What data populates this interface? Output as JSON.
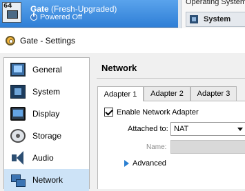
{
  "vm_list": {
    "selected_vm": {
      "arch_badge": "64",
      "name": "Gate",
      "snapshot": "(Fresh-Upgraded)",
      "state": "Powered Off"
    }
  },
  "details": {
    "os_label": "Operating System:",
    "system_header": "System"
  },
  "dialog": {
    "title": "Gate - Settings",
    "sidebar": [
      {
        "label": "General",
        "icon": "general-icon"
      },
      {
        "label": "System",
        "icon": "system-icon"
      },
      {
        "label": "Display",
        "icon": "display-icon"
      },
      {
        "label": "Storage",
        "icon": "storage-icon"
      },
      {
        "label": "Audio",
        "icon": "audio-icon"
      },
      {
        "label": "Network",
        "icon": "network-icon",
        "selected": true
      }
    ],
    "section_title": "Network",
    "tabs": [
      {
        "label": "Adapter 1",
        "active": true
      },
      {
        "label": "Adapter 2"
      },
      {
        "label": "Adapter 3"
      }
    ],
    "adapter": {
      "enable_label": "Enable Network Adapter",
      "enabled": true,
      "attached_label": "Attached to:",
      "attached_value": "NAT",
      "name_label": "Name:",
      "name_value": "",
      "advanced_label": "Advanced"
    }
  },
  "colors": {
    "selection_blue": "#2f7fd6",
    "sidebar_selected": "#cde3f7",
    "advanced_arrow": "#2a7fd1"
  }
}
